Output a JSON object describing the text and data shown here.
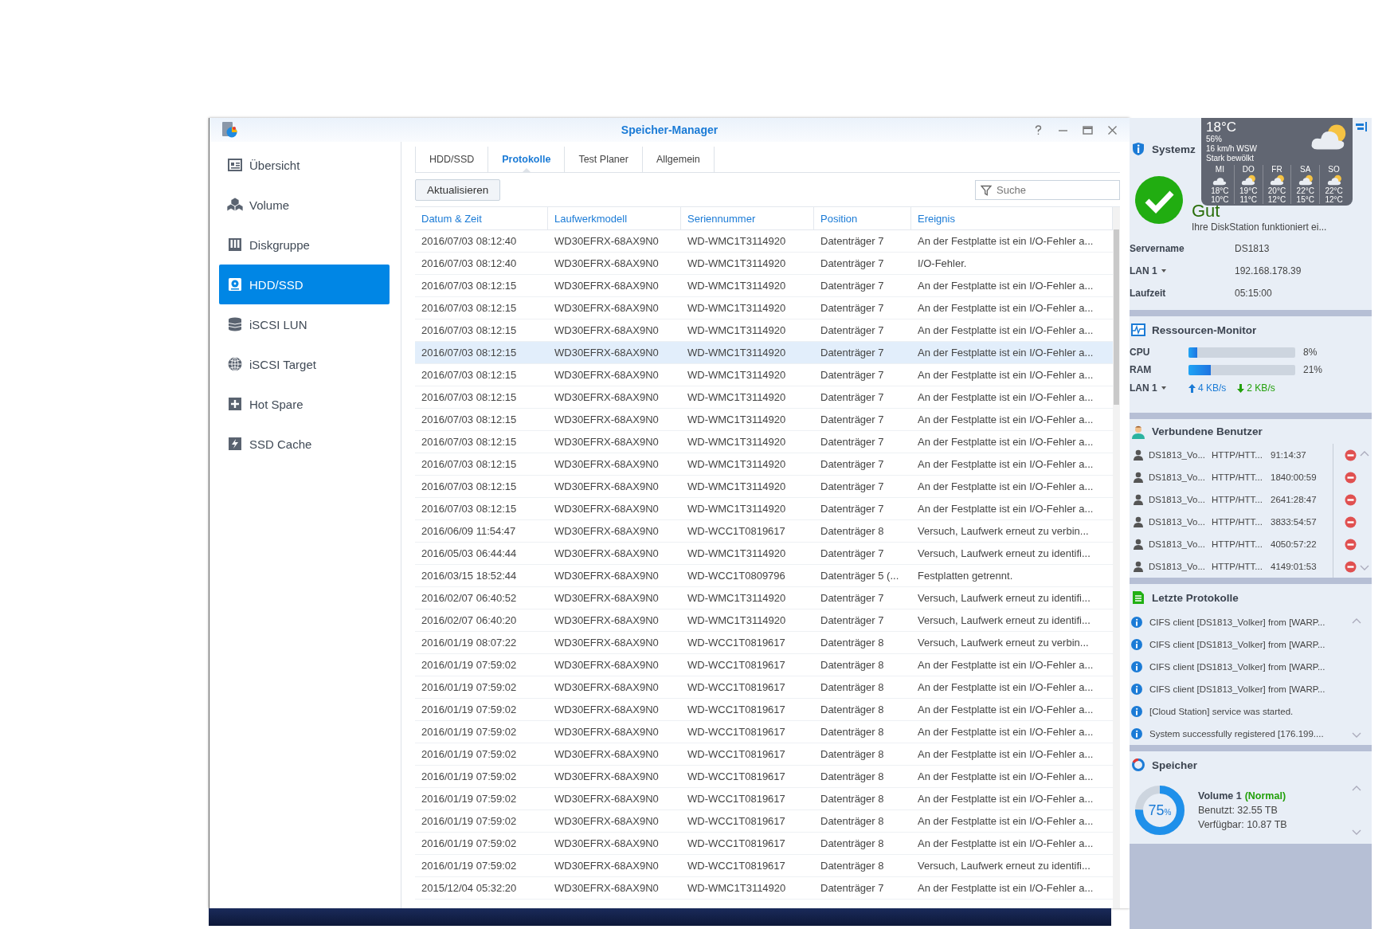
{
  "window": {
    "title": "Speicher-Manager"
  },
  "sidebar": {
    "items": [
      {
        "label": "Übersicht",
        "selected": false
      },
      {
        "label": "Volume",
        "selected": false
      },
      {
        "label": "Diskgruppe",
        "selected": false
      },
      {
        "label": "HDD/SSD",
        "selected": true
      },
      {
        "label": "iSCSI LUN",
        "selected": false
      },
      {
        "label": "iSCSI Target",
        "selected": false
      },
      {
        "label": "Hot Spare",
        "selected": false
      },
      {
        "label": "SSD Cache",
        "selected": false
      }
    ]
  },
  "tabs": [
    {
      "label": "HDD/SSD",
      "selected": false
    },
    {
      "label": "Protokolle",
      "selected": true
    },
    {
      "label": "Test Planer",
      "selected": false
    },
    {
      "label": "Allgemein",
      "selected": false
    }
  ],
  "toolbar": {
    "refresh_button": "Aktualisieren",
    "search": {
      "placeholder": "Suche"
    }
  },
  "table": {
    "columns": [
      "Datum & Zeit",
      "Laufwerkmodell",
      "Seriennummer",
      "Position",
      "Ereignis"
    ],
    "rows": [
      {
        "cells": [
          "2016/07/03 08:12:40",
          "WD30EFRX-68AX9N0",
          "WD-WMC1T3114920",
          "Datenträger 7",
          "An der Festplatte ist ein I/O-Fehler a..."
        ],
        "selected": false
      },
      {
        "cells": [
          "2016/07/03 08:12:40",
          "WD30EFRX-68AX9N0",
          "WD-WMC1T3114920",
          "Datenträger 7",
          "I/O-Fehler."
        ],
        "selected": false
      },
      {
        "cells": [
          "2016/07/03 08:12:15",
          "WD30EFRX-68AX9N0",
          "WD-WMC1T3114920",
          "Datenträger 7",
          "An der Festplatte ist ein I/O-Fehler a..."
        ],
        "selected": false
      },
      {
        "cells": [
          "2016/07/03 08:12:15",
          "WD30EFRX-68AX9N0",
          "WD-WMC1T3114920",
          "Datenträger 7",
          "An der Festplatte ist ein I/O-Fehler a..."
        ],
        "selected": false
      },
      {
        "cells": [
          "2016/07/03 08:12:15",
          "WD30EFRX-68AX9N0",
          "WD-WMC1T3114920",
          "Datenträger 7",
          "An der Festplatte ist ein I/O-Fehler a..."
        ],
        "selected": false
      },
      {
        "cells": [
          "2016/07/03 08:12:15",
          "WD30EFRX-68AX9N0",
          "WD-WMC1T3114920",
          "Datenträger 7",
          "An der Festplatte ist ein I/O-Fehler a..."
        ],
        "selected": true
      },
      {
        "cells": [
          "2016/07/03 08:12:15",
          "WD30EFRX-68AX9N0",
          "WD-WMC1T3114920",
          "Datenträger 7",
          "An der Festplatte ist ein I/O-Fehler a..."
        ],
        "selected": false
      },
      {
        "cells": [
          "2016/07/03 08:12:15",
          "WD30EFRX-68AX9N0",
          "WD-WMC1T3114920",
          "Datenträger 7",
          "An der Festplatte ist ein I/O-Fehler a..."
        ],
        "selected": false
      },
      {
        "cells": [
          "2016/07/03 08:12:15",
          "WD30EFRX-68AX9N0",
          "WD-WMC1T3114920",
          "Datenträger 7",
          "An der Festplatte ist ein I/O-Fehler a..."
        ],
        "selected": false
      },
      {
        "cells": [
          "2016/07/03 08:12:15",
          "WD30EFRX-68AX9N0",
          "WD-WMC1T3114920",
          "Datenträger 7",
          "An der Festplatte ist ein I/O-Fehler a..."
        ],
        "selected": false
      },
      {
        "cells": [
          "2016/07/03 08:12:15",
          "WD30EFRX-68AX9N0",
          "WD-WMC1T3114920",
          "Datenträger 7",
          "An der Festplatte ist ein I/O-Fehler a..."
        ],
        "selected": false
      },
      {
        "cells": [
          "2016/07/03 08:12:15",
          "WD30EFRX-68AX9N0",
          "WD-WMC1T3114920",
          "Datenträger 7",
          "An der Festplatte ist ein I/O-Fehler a..."
        ],
        "selected": false
      },
      {
        "cells": [
          "2016/07/03 08:12:15",
          "WD30EFRX-68AX9N0",
          "WD-WMC1T3114920",
          "Datenträger 7",
          "An der Festplatte ist ein I/O-Fehler a..."
        ],
        "selected": false
      },
      {
        "cells": [
          "2016/06/09 11:54:47",
          "WD30EFRX-68AX9N0",
          "WD-WCC1T0819617",
          "Datenträger 8",
          "Versuch, Laufwerk erneut zu verbin..."
        ],
        "selected": false
      },
      {
        "cells": [
          "2016/05/03 06:44:44",
          "WD30EFRX-68AX9N0",
          "WD-WMC1T3114920",
          "Datenträger 7",
          "Versuch, Laufwerk erneut zu identifi..."
        ],
        "selected": false
      },
      {
        "cells": [
          "2016/03/15 18:52:44",
          "WD30EFRX-68AX9N0",
          "WD-WCC1T0809796",
          "Datenträger 5 (...",
          "Festplatten getrennt."
        ],
        "selected": false
      },
      {
        "cells": [
          "2016/02/07 06:40:52",
          "WD30EFRX-68AX9N0",
          "WD-WMC1T3114920",
          "Datenträger 7",
          "Versuch, Laufwerk erneut zu identifi..."
        ],
        "selected": false
      },
      {
        "cells": [
          "2016/02/07 06:40:20",
          "WD30EFRX-68AX9N0",
          "WD-WMC1T3114920",
          "Datenträger 7",
          "Versuch, Laufwerk erneut zu identifi..."
        ],
        "selected": false
      },
      {
        "cells": [
          "2016/01/19 08:07:22",
          "WD30EFRX-68AX9N0",
          "WD-WCC1T0819617",
          "Datenträger 8",
          "Versuch, Laufwerk erneut zu verbin..."
        ],
        "selected": false
      },
      {
        "cells": [
          "2016/01/19 07:59:02",
          "WD30EFRX-68AX9N0",
          "WD-WCC1T0819617",
          "Datenträger 8",
          "An der Festplatte ist ein I/O-Fehler a..."
        ],
        "selected": false
      },
      {
        "cells": [
          "2016/01/19 07:59:02",
          "WD30EFRX-68AX9N0",
          "WD-WCC1T0819617",
          "Datenträger 8",
          "An der Festplatte ist ein I/O-Fehler a..."
        ],
        "selected": false
      },
      {
        "cells": [
          "2016/01/19 07:59:02",
          "WD30EFRX-68AX9N0",
          "WD-WCC1T0819617",
          "Datenträger 8",
          "An der Festplatte ist ein I/O-Fehler a..."
        ],
        "selected": false
      },
      {
        "cells": [
          "2016/01/19 07:59:02",
          "WD30EFRX-68AX9N0",
          "WD-WCC1T0819617",
          "Datenträger 8",
          "An der Festplatte ist ein I/O-Fehler a..."
        ],
        "selected": false
      },
      {
        "cells": [
          "2016/01/19 07:59:02",
          "WD30EFRX-68AX9N0",
          "WD-WCC1T0819617",
          "Datenträger 8",
          "An der Festplatte ist ein I/O-Fehler a..."
        ],
        "selected": false
      },
      {
        "cells": [
          "2016/01/19 07:59:02",
          "WD30EFRX-68AX9N0",
          "WD-WCC1T0819617",
          "Datenträger 8",
          "An der Festplatte ist ein I/O-Fehler a..."
        ],
        "selected": false
      },
      {
        "cells": [
          "2016/01/19 07:59:02",
          "WD30EFRX-68AX9N0",
          "WD-WCC1T0819617",
          "Datenträger 8",
          "An der Festplatte ist ein I/O-Fehler a..."
        ],
        "selected": false
      },
      {
        "cells": [
          "2016/01/19 07:59:02",
          "WD30EFRX-68AX9N0",
          "WD-WCC1T0819617",
          "Datenträger 8",
          "An der Festplatte ist ein I/O-Fehler a..."
        ],
        "selected": false
      },
      {
        "cells": [
          "2016/01/19 07:59:02",
          "WD30EFRX-68AX9N0",
          "WD-WCC1T0819617",
          "Datenträger 8",
          "An der Festplatte ist ein I/O-Fehler a..."
        ],
        "selected": false
      },
      {
        "cells": [
          "2016/01/19 07:59:02",
          "WD30EFRX-68AX9N0",
          "WD-WCC1T0819617",
          "Datenträger 8",
          "Versuch, Laufwerk erneut zu identifi..."
        ],
        "selected": false
      },
      {
        "cells": [
          "2015/12/04 05:32:20",
          "WD30EFRX-68AX9N0",
          "WD-WMC1T3114920",
          "Datenträger 7",
          "An der Festplatte ist ein I/O-Fehler a..."
        ],
        "selected": false
      }
    ]
  },
  "right_panel": {
    "weather": {
      "temperature": "18°C",
      "humidity": "56%",
      "wind": "16 km/h WSW",
      "condition": "Stark bewölkt",
      "forecast": [
        {
          "day": "MI",
          "high": "18°C",
          "low": "10°C"
        },
        {
          "day": "DO",
          "high": "19°C",
          "low": "11°C"
        },
        {
          "day": "FR",
          "high": "20°C",
          "low": "12°C"
        },
        {
          "day": "SA",
          "high": "22°C",
          "low": "15°C"
        },
        {
          "day": "SO",
          "high": "22°C",
          "low": "12°C"
        }
      ]
    },
    "system_status": {
      "title": "Systemz",
      "status": "Gut",
      "description": "Ihre DiskStation funktioniert ei...",
      "info": [
        {
          "label": "Servername",
          "value": "DS1813",
          "dropdown": false
        },
        {
          "label": "LAN 1",
          "value": "192.168.178.39",
          "dropdown": true
        },
        {
          "label": "Laufzeit",
          "value": "05:15:00",
          "dropdown": false
        }
      ]
    },
    "resource_monitor": {
      "title": "Ressourcen-Monitor",
      "meters": [
        {
          "label": "CPU",
          "level": 0.08,
          "reading": "8%"
        },
        {
          "label": "RAM",
          "level": 0.21,
          "reading": "21%"
        }
      ],
      "network": {
        "label": "LAN 1",
        "upload": "4 KB/s",
        "download": "2 KB/s"
      }
    },
    "connected_users": {
      "title": "Verbundene Benutzer",
      "users": [
        {
          "name": "DS1813_Vo...",
          "protocol": "HTTP/HTT...",
          "duration": "91:14:37"
        },
        {
          "name": "DS1813_Vo...",
          "protocol": "HTTP/HTT...",
          "duration": "1840:00:59"
        },
        {
          "name": "DS1813_Vo...",
          "protocol": "HTTP/HTT...",
          "duration": "2641:28:47"
        },
        {
          "name": "DS1813_Vo...",
          "protocol": "HTTP/HTT...",
          "duration": "3833:54:57"
        },
        {
          "name": "DS1813_Vo...",
          "protocol": "HTTP/HTT...",
          "duration": "4050:57:22"
        },
        {
          "name": "DS1813_Vo...",
          "protocol": "HTTP/HTT...",
          "duration": "4149:01:53"
        }
      ]
    },
    "recent_logs": {
      "title": "Letzte Protokolle",
      "entries": [
        "CIFS client [DS1813_Volker] from [WARP...",
        "CIFS client [DS1813_Volker] from [WARP...",
        "CIFS client [DS1813_Volker] from [WARP...",
        "CIFS client [DS1813_Volker] from [WARP...",
        "[Cloud Station] service was started.",
        "System successfully registered [176.199...."
      ]
    },
    "storage": {
      "title": "Speicher",
      "volumes": [
        {
          "name": "Volume 1",
          "status": "(Normal)",
          "used": "Benutzt: 32.55 TB",
          "available": "Verfügbar: 10.87 TB",
          "level": 0.75,
          "percent": "75",
          "unit": "%"
        }
      ]
    }
  }
}
